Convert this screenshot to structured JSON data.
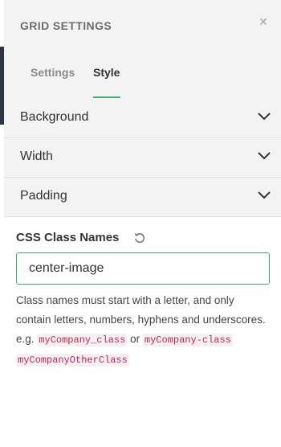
{
  "panel": {
    "title": "GRID SETTINGS",
    "close_symbol": "×"
  },
  "tabs": [
    {
      "label": "Settings",
      "active": false
    },
    {
      "label": "Style",
      "active": true
    }
  ],
  "sections": [
    {
      "label": "Background",
      "icon": "chevron-down-icon"
    },
    {
      "label": "Width",
      "icon": "chevron-down-icon"
    },
    {
      "label": "Padding",
      "icon": "chevron-down-icon"
    }
  ],
  "css_classes": {
    "title": "CSS Class Names",
    "reset_icon": "reset-icon",
    "input_value": "center-image",
    "help_text": "Class names must start with a letter, and only contain letters, numbers, hyphens and underscores.",
    "example_prefix": "e.g.",
    "example_1": "myCompany_class",
    "example_or": "or",
    "example_2": "myCompany-class",
    "example_3": "myCompanyOtherClass"
  },
  "colors": {
    "accent": "#3db06b",
    "code_text": "#c7254e",
    "header_bg": "#f3f3f3"
  }
}
